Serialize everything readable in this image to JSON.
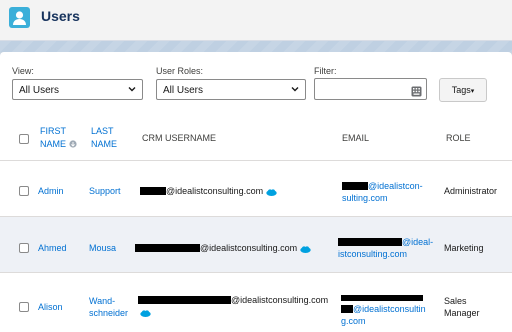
{
  "header": {
    "title": "Users",
    "icon": "user-icon"
  },
  "filters": {
    "view_label": "View:",
    "view_value": "All Users",
    "roles_label": "User Roles:",
    "roles_value": "All Users",
    "filter_label": "Filter:",
    "filter_value": "",
    "tags_label": "Tags",
    "tags_caret": "▾"
  },
  "table": {
    "headers": {
      "first_name_1": "FIRST",
      "first_name_2": "NAME",
      "last_name_1": "LAST",
      "last_name_2": "NAME",
      "crm_username": "CRM USERNAME",
      "email": "EMAIL",
      "role": "ROLE"
    },
    "rows": [
      {
        "first": "Admin",
        "last_1": "Support",
        "last_2": "",
        "username_domain": "@idealistconsulting.com",
        "email_line1": "@idealistcon-",
        "email_line2": "sulting.com",
        "role_1": "Administrator",
        "role_2": ""
      },
      {
        "first": "Ahmed",
        "last_1": "Mousa",
        "last_2": "",
        "username_domain": "@idealistconsulting.com",
        "email_line1": "@ideal-",
        "email_line2": "istconsulting.com",
        "role_1": "Marketing",
        "role_2": ""
      },
      {
        "first": "Alison",
        "last_1": "Wand-",
        "last_2": "schneider",
        "username_domain": "@idealistconsulting.com",
        "email_line1": "@idealistconsultin",
        "email_line2": "g.com",
        "role_1": "Sales",
        "role_2": "Manager"
      }
    ]
  },
  "colors": {
    "brand_blue": "#0070d2",
    "salesforce_cloud": "#00a1e0",
    "header_icon": "#3bafd9"
  }
}
